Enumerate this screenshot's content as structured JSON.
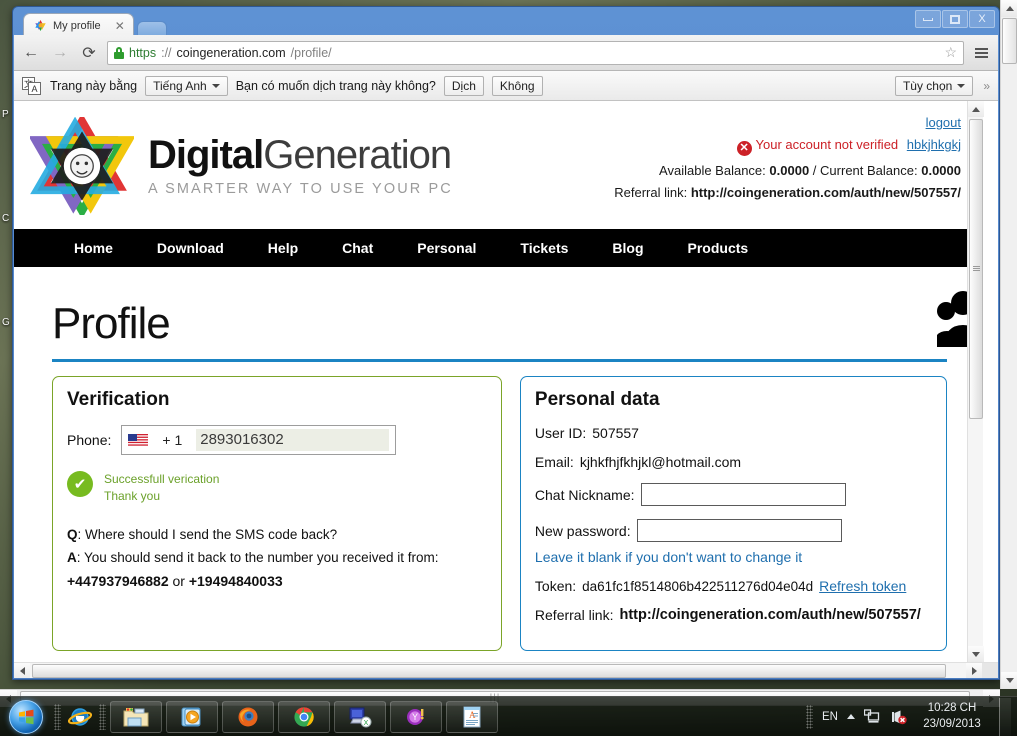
{
  "os": {
    "desktop_icon_labels": [
      "P",
      "C",
      "G"
    ],
    "taskbar": {
      "start_label": "Start",
      "quicklaunch": [
        {
          "name": "internet-explorer-icon",
          "label": "Internet Explorer"
        }
      ],
      "tasks": [
        {
          "name": "windows-explorer-icon",
          "label": "Windows Explorer"
        },
        {
          "name": "media-player-icon",
          "label": "Windows Media Player"
        },
        {
          "name": "firefox-icon",
          "label": "Mozilla Firefox"
        },
        {
          "name": "chrome-icon",
          "label": "Google Chrome"
        },
        {
          "name": "teamviewer-icon",
          "label": "TeamViewer"
        },
        {
          "name": "yahoo-messenger-icon",
          "label": "Yahoo! Messenger"
        },
        {
          "name": "wordpad-icon",
          "label": "WordPad"
        }
      ],
      "tray": {
        "language": "EN",
        "show_hidden_icons": "▲",
        "network_icon": "network-icon",
        "volume_icon": "volume-muted-icon",
        "time": "10:28 CH",
        "date": "23/09/2013"
      }
    },
    "scrollbars": {
      "vertical_present": true,
      "horizontal_present": true
    }
  },
  "browser": {
    "window_controls": {
      "minimize": "minimize-button",
      "maximize": "maximize-button",
      "close": "X"
    },
    "tabs": [
      {
        "title": "My profile",
        "favicon": "rainbow-star-favicon",
        "close": "✕",
        "active": true
      }
    ],
    "new_tab_label": "New Tab",
    "nav": {
      "back": "←",
      "forward": "→",
      "reload": "⟳"
    },
    "omnibox": {
      "security_icon": "https-lock-icon",
      "scheme": "https",
      "separator": "://",
      "host": "coingeneration.com",
      "path": "/profile/",
      "bookmark_star": "☆"
    },
    "menu_button": "chrome-menu-button",
    "translate_bar": {
      "icon": "translate-icon",
      "icon_top_char": "文",
      "icon_bottom_char": "A",
      "text_before": "Trang này bằng",
      "language_selected": "Tiếng Anh",
      "question": "Bạn có muốn dịch trang này không?",
      "translate_button": "Dịch",
      "nope_button": "Không",
      "options_button": "Tùy chọn",
      "overflow": "»"
    }
  },
  "site": {
    "logo": {
      "mark_name": "rainbow-star-lion-logo",
      "brand_bold": "Digital",
      "brand_light": "Generation",
      "tagline": "A SMARTER WAY TO USE YOUR PC"
    },
    "account": {
      "logout_label": "logout",
      "status_icon": "error-icon",
      "status_text": "Your account not verified",
      "username": "hbkjhkgkj",
      "available_balance_label": "Available Balance:",
      "available_balance": "0.0000",
      "balance_separator": "/",
      "current_balance_label": "Current Balance:",
      "current_balance": "0.0000",
      "referral_label": "Referral link:",
      "referral_value": "http://coingeneration.com/auth/new/507557/"
    },
    "nav_items": [
      "Home",
      "Download",
      "Help",
      "Chat",
      "Personal",
      "Tickets",
      "Blog",
      "Products"
    ],
    "page_title": "Profile",
    "people_icon": "people-group-icon",
    "verification": {
      "heading": "Verification",
      "phone_label": "Phone:",
      "country_flag": "us-flag-icon",
      "country_code": "+ 1",
      "phone_number": "2893016302",
      "status_icon": "check-circle-icon",
      "status_line1": "Successfull verication",
      "status_line2": "Thank you",
      "q_key": "Q",
      "q_text": ": Where should I send the SMS code back?",
      "a_key": "A",
      "a_text": ": You should send it back to the number you received it from:",
      "number_1": "+447937946882",
      "number_join": "or",
      "number_2": "+19494840033"
    },
    "personal_data": {
      "heading": "Personal data",
      "user_id_label": "User ID:",
      "user_id": "507557",
      "email_label": "Email:",
      "email": "kjhkfhjfkhjkl@hotmail.com",
      "nickname_label": "Chat Nickname:",
      "nickname_value": "",
      "password_label": "New password:",
      "password_value": "",
      "password_hint": "Leave it blank if you don't want to change it",
      "token_label": "Token:",
      "token_value": "da61fc1f8514806b422511276d04e04d",
      "refresh_token_link": "Refresh token",
      "referral_label": "Referral link:",
      "referral_value": "http://coingeneration.com/auth/new/507557/"
    }
  },
  "colors": {
    "nav_bg": "#000000",
    "title_rule": "#1b84c3",
    "verification_border": "#7ba428",
    "personal_border": "#1b84c3",
    "link": "#1f6fae",
    "error": "#cc2127",
    "success": "#77bb20"
  }
}
